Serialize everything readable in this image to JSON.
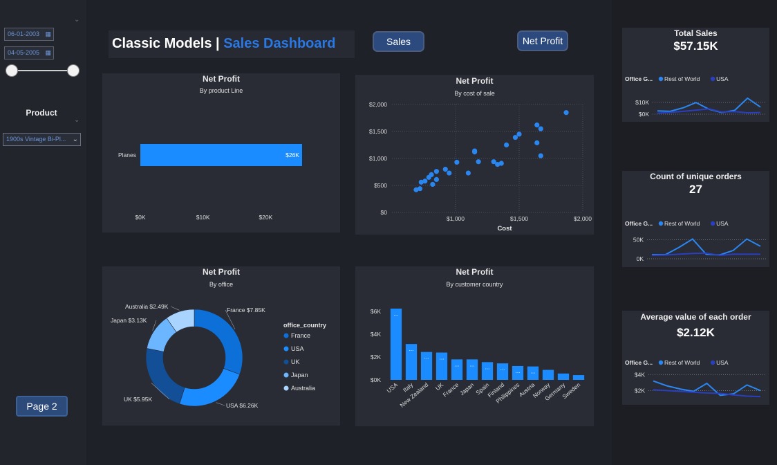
{
  "filters": {
    "start_date": "06-01-2003",
    "end_date": "04-05-2005",
    "product_title": "Product",
    "product_selected": "1900s Vintage Bi-Pl..."
  },
  "page2_button": "Page 2",
  "header": {
    "title_main": "Classic Models | ",
    "title_accent": "Sales Dashboard"
  },
  "nav": {
    "sales": "Sales",
    "net_profit": "Net Profit"
  },
  "colors": {
    "accent": "#1a8cff",
    "dark_blue": "#0d4fa8",
    "light_blue": "#9fd0ff",
    "card_bg": "#292c35"
  },
  "chart_data": [
    {
      "type": "bar",
      "orientation": "horizontal",
      "title": "Net Profit",
      "subtitle": "By product Line",
      "categories": [
        "Planes"
      ],
      "values": [
        25800
      ],
      "data_labels": [
        "$26K"
      ],
      "xlim": [
        0,
        29000
      ],
      "xticks": [
        0,
        10000,
        20000
      ],
      "xtick_labels": [
        "$0K",
        "$10K",
        "$20K"
      ]
    },
    {
      "type": "scatter",
      "title": "Net Profit",
      "subtitle": "By cost of sale",
      "xlabel": "Cost",
      "xlim": [
        500,
        2000
      ],
      "ylim": [
        0,
        2000
      ],
      "xticks": [
        1000,
        1500,
        2000
      ],
      "xtick_labels": [
        "$1,000",
        "$1,500",
        "$2,000"
      ],
      "yticks": [
        0,
        500,
        1000,
        1500,
        2000
      ],
      "ytick_labels": [
        "$0",
        "$500",
        "$1,000",
        "$1,500",
        "$2,000"
      ],
      "points": [
        [
          690,
          420
        ],
        [
          720,
          440
        ],
        [
          730,
          560
        ],
        [
          760,
          580
        ],
        [
          790,
          650
        ],
        [
          820,
          520
        ],
        [
          810,
          700
        ],
        [
          850,
          760
        ],
        [
          850,
          610
        ],
        [
          920,
          800
        ],
        [
          950,
          730
        ],
        [
          1010,
          930
        ],
        [
          1100,
          730
        ],
        [
          1150,
          1140
        ],
        [
          1150,
          1120
        ],
        [
          1180,
          940
        ],
        [
          1300,
          940
        ],
        [
          1330,
          890
        ],
        [
          1360,
          910
        ],
        [
          1400,
          1250
        ],
        [
          1470,
          1390
        ],
        [
          1500,
          1450
        ],
        [
          1640,
          1620
        ],
        [
          1670,
          1550
        ],
        [
          1640,
          1290
        ],
        [
          1670,
          1050
        ],
        [
          1870,
          1850
        ]
      ]
    },
    {
      "type": "pie",
      "donut": true,
      "title": "Net Profit",
      "subtitle": "By office",
      "legend_title": "office_country",
      "legend_position": "right",
      "slices": [
        {
          "name": "France",
          "value": 7.85,
          "label": "France $7.85K",
          "color": "#0d6fd8"
        },
        {
          "name": "USA",
          "value": 6.26,
          "label": "USA $6.26K",
          "color": "#1a8cff"
        },
        {
          "name": "UK",
          "value": 5.95,
          "label": "UK $5.95K",
          "color": "#124f96"
        },
        {
          "name": "Japan",
          "value": 3.13,
          "label": "Japan $3.13K",
          "color": "#6cb6ff"
        },
        {
          "name": "Australia",
          "value": 2.49,
          "label": "Australia $2.49K",
          "color": "#a8d4ff"
        }
      ]
    },
    {
      "type": "bar",
      "title": "Net Profit",
      "subtitle": "By customer country",
      "categories": [
        "USA",
        "Italy",
        "New Zealand",
        "UK",
        "France",
        "Japan",
        "Spain",
        "Finland",
        "Philippines",
        "Austria",
        "Norway",
        "Germany",
        "Sweden"
      ],
      "values": [
        6260,
        3150,
        2450,
        2400,
        1800,
        1800,
        1560,
        1450,
        1220,
        1180,
        880,
        560,
        420
      ],
      "data_labels": [
        "...",
        "...",
        "...",
        "...",
        "...",
        "...",
        "...",
        "...",
        "...",
        "...",
        "",
        "",
        ""
      ],
      "ylim": [
        0,
        6500
      ],
      "yticks": [
        0,
        2000,
        4000,
        6000
      ],
      "ytick_labels": [
        "$0K",
        "$2K",
        "$4K",
        "$6K"
      ]
    },
    {
      "type": "line",
      "title": "Total Sales",
      "kpi_value": "$57.15K",
      "legend_title": "Office G...",
      "series": [
        {
          "name": "Rest of World",
          "values": [
            2800,
            2400,
            5400,
            9800,
            4200,
            1400,
            3200,
            13500,
            6000
          ],
          "color": "#2a86f0"
        },
        {
          "name": "USA",
          "values": [
            800,
            1500,
            2400,
            3400,
            4500,
            1800,
            2200,
            1200,
            1400
          ],
          "color": "#2a3fc0"
        }
      ],
      "ylim": [
        0,
        14000
      ],
      "yticks": [
        0,
        10000
      ],
      "ytick_labels": [
        "$0K",
        "$10K"
      ]
    },
    {
      "type": "line",
      "title": "Count of unique orders",
      "kpi_value": "27",
      "legend_title": "Office G...",
      "series": [
        {
          "name": "Rest of World",
          "values": [
            11000,
            11000,
            30000,
            52000,
            12000,
            10000,
            22000,
            52000,
            33000
          ],
          "color": "#2a86f0"
        },
        {
          "name": "USA",
          "values": [
            9000,
            10000,
            12000,
            14000,
            15000,
            9000,
            12000,
            12000,
            12000
          ],
          "color": "#2a3fc0"
        }
      ],
      "ylim": [
        0,
        60000
      ],
      "yticks": [
        0,
        50000
      ],
      "ytick_labels": [
        "0K",
        "50K"
      ]
    },
    {
      "type": "line",
      "title": "Average value of each order",
      "kpi_value": "$2.12K",
      "legend_title": "Office G...",
      "series": [
        {
          "name": "Rest of World",
          "values": [
            3200,
            2600,
            2200,
            1900,
            2900,
            1400,
            1600,
            2700,
            2000
          ],
          "color": "#2a86f0"
        },
        {
          "name": "USA",
          "values": [
            2100,
            2000,
            1900,
            1800,
            1700,
            1650,
            1450,
            1300,
            1250
          ],
          "color": "#2a3fc0"
        }
      ],
      "ylim": [
        1000,
        4200
      ],
      "yticks": [
        2000,
        4000
      ],
      "ytick_labels": [
        "$2K",
        "$4K"
      ]
    }
  ]
}
